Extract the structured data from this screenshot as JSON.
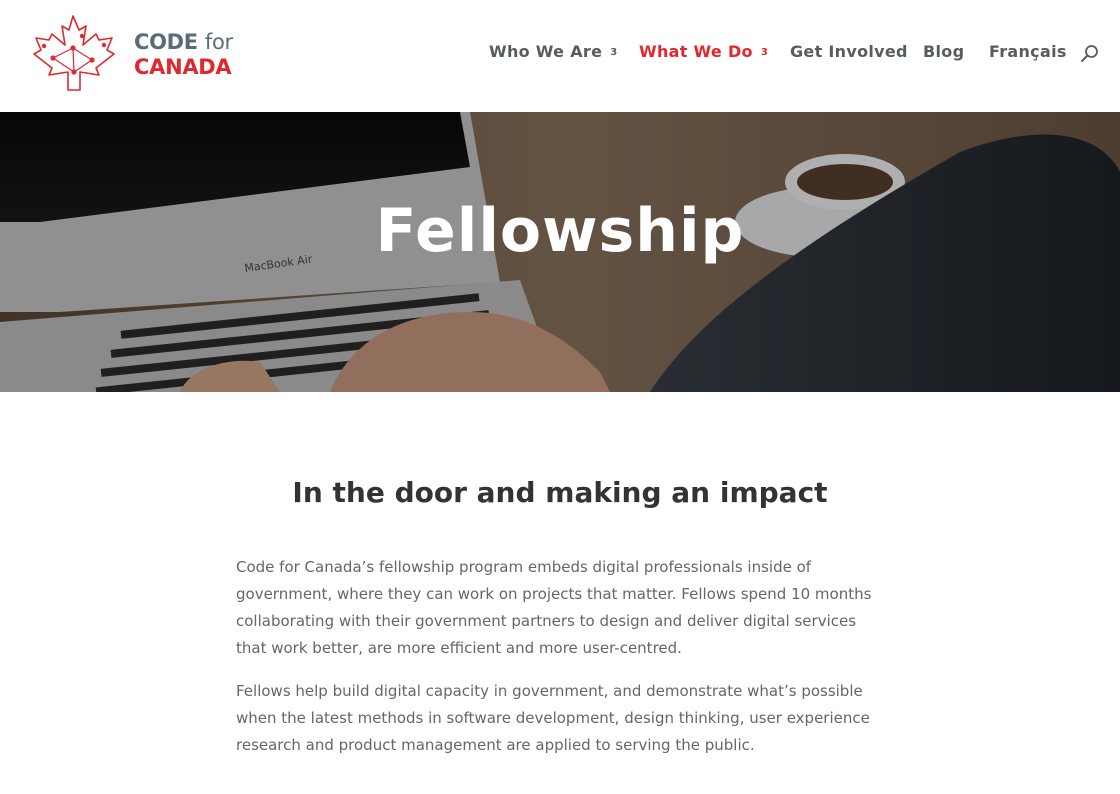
{
  "brand": {
    "line1_code": "CODE",
    "line1_for": "for",
    "line2": "CANADA",
    "colors": {
      "red": "#e0282e",
      "slate": "#5b6c79"
    }
  },
  "nav": {
    "items": [
      {
        "label": "Who We Are",
        "has_dropdown": true,
        "active": false
      },
      {
        "label": "What We Do",
        "has_dropdown": true,
        "active": true
      },
      {
        "label": "Get Involved",
        "has_dropdown": false,
        "active": false
      },
      {
        "label": "Blog",
        "has_dropdown": false,
        "active": false
      },
      {
        "label": "Français",
        "has_dropdown": false,
        "active": false
      }
    ],
    "dropdown_glyph": "3",
    "search_icon": "search-icon"
  },
  "hero": {
    "title": "Fellowship",
    "laptop_label": "MacBook Air"
  },
  "main": {
    "heading": "In the door and making an impact",
    "paragraphs": [
      "Code for Canada’s fellowship program embeds digital professionals inside of government, where they can work on projects that matter. Fellows spend 10 months collaborating with their government partners to design and deliver digital services that work better, are more efficient and more user-centred.",
      "Fellows help build digital capacity in government, and demonstrate what’s possible when the latest methods in software development, design thinking, user experience research and product management are applied to serving the public."
    ]
  }
}
